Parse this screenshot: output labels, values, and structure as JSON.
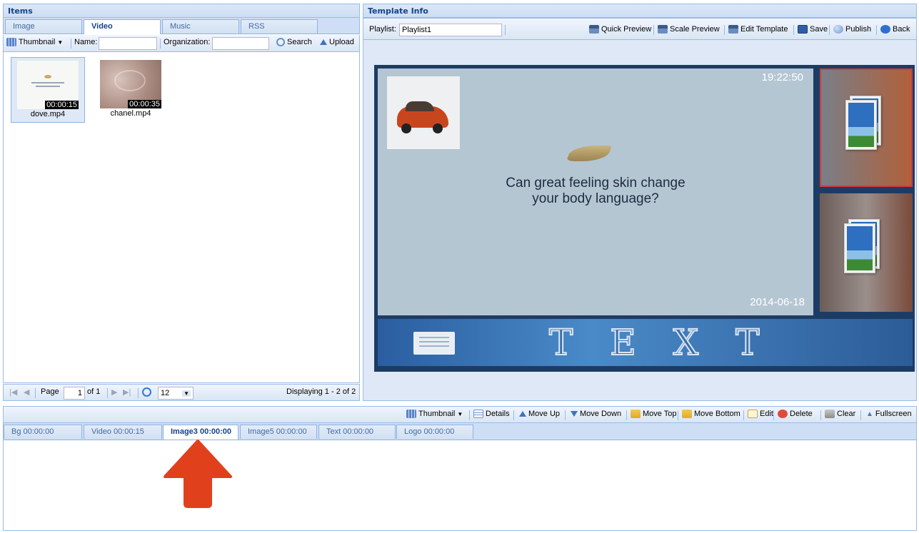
{
  "items_panel": {
    "title": "Items",
    "tabs": [
      "Image",
      "Video",
      "Music",
      "RSS"
    ],
    "active_tab": "Video",
    "toolbar": {
      "view_label": "Thumbnail",
      "name_label": "Name:",
      "name_value": "",
      "organization_label": "Organization:",
      "organization_value": "",
      "search_label": "Search",
      "upload_label": "Upload"
    },
    "videos": [
      {
        "name": "dove.mp4",
        "duration": "00:00:15"
      },
      {
        "name": "chanel.mp4",
        "duration": "00:00:35"
      }
    ],
    "pager": {
      "page_label": "Page",
      "page_value": "1",
      "of_label": "of 1",
      "page_size": "12",
      "display_text": "Displaying 1 - 2 of 2"
    }
  },
  "template_panel": {
    "title": "Template Info",
    "playlist_label": "Playlist:",
    "playlist_value": "Playlist1",
    "actions": [
      "Quick Preview",
      "Scale Preview",
      "Edit Template",
      "Save",
      "Publish",
      "Back"
    ],
    "preview": {
      "time": "19:22:50",
      "date": "2014-06-18",
      "headline_line1": "Can great feeling skin change",
      "headline_line2": "your body language?",
      "text_banner": "T E X T"
    }
  },
  "timeline": {
    "toolbar": [
      "Thumbnail",
      "Details",
      "Move Up",
      "Move Down",
      "Move Top",
      "Move Bottom",
      "Edit",
      "Delete",
      "Clear",
      "Fullscreen"
    ],
    "tabs": [
      "Bg  00:00:00",
      "Video 00:00:15",
      "Image3 00:00:00",
      "Image5 00:00:00",
      "Text 00:00:00",
      "Logo 00:00:00"
    ],
    "active_tab": "Image3 00:00:00"
  },
  "colors": {
    "header_bg": "#cddef3",
    "border": "#99bbe8",
    "frame": "#1d3c64",
    "arrow": "#e0401c"
  }
}
